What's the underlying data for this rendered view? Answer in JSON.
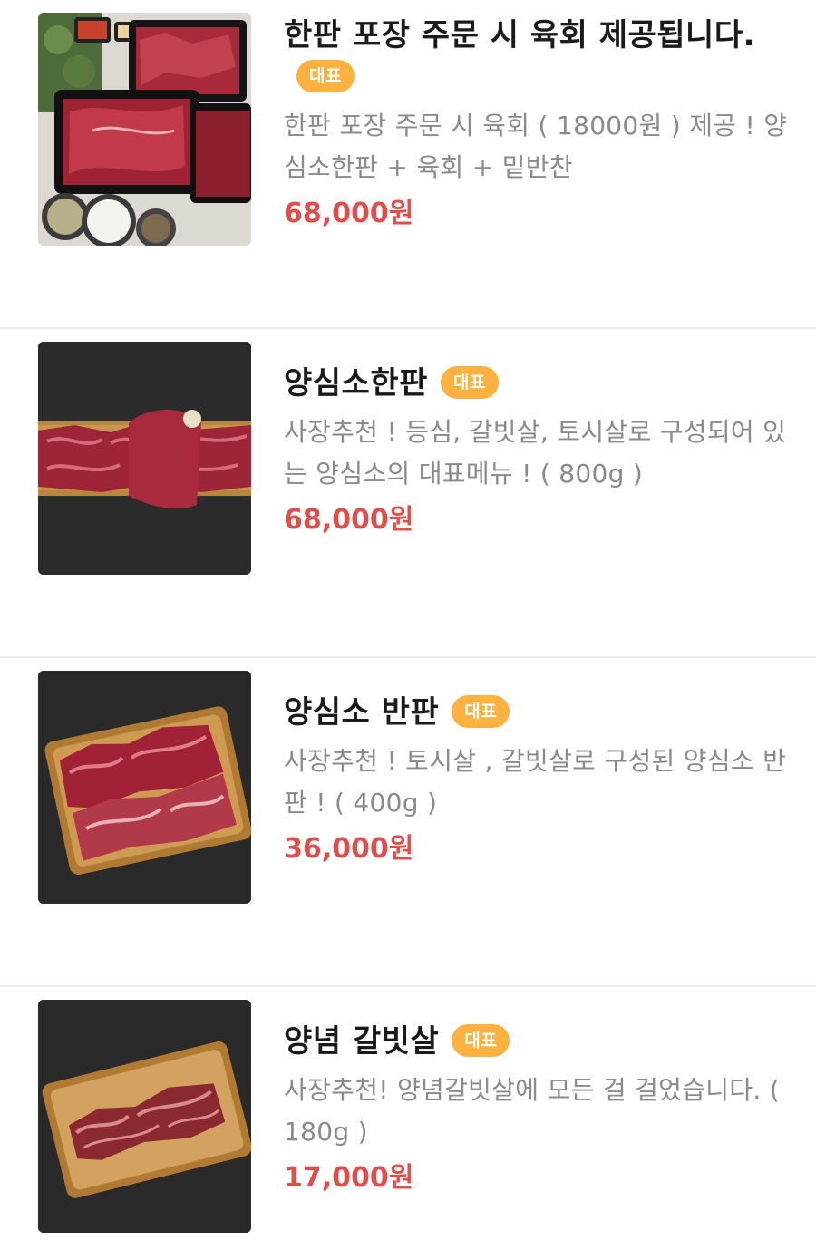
{
  "colors": {
    "badge": "#fdb23f",
    "price": "#e14d4b",
    "description": "#8a8a8a",
    "title": "#1a1a1a",
    "divider": "#ececec"
  },
  "menu": [
    {
      "name": "한판 포장 주문 시 육회 제공됩니다.",
      "badge": "대표",
      "description": "한판 포장 주문 시 육회 ( 18000원 ) 제공 ! 양심소한판 + 육회 + 밑반찬",
      "price": "68,000원",
      "image_icon": "takeout-meat-platter-photo"
    },
    {
      "name": "양심소한판",
      "badge": "대표",
      "description": "사장추천 ! 등심, 갈빗살, 토시살로 구성되어 있는 양심소의 대표메뉴 ! ( 800g )",
      "price": "68,000원",
      "image_icon": "beef-board-photo"
    },
    {
      "name": "양심소 반판",
      "badge": "대표",
      "description": "사장추천 ! 토시살 , 갈빗살로 구성된 양심소 반판 ! ( 400g )",
      "price": "36,000원",
      "image_icon": "beef-half-board-photo"
    },
    {
      "name": "양념 갈빗살",
      "badge": "대표",
      "description": "사장추천! 양념갈빗살에 모든 걸 걸었습니다. ( 180g )",
      "price": "17,000원",
      "image_icon": "marinated-rib-board-photo"
    }
  ]
}
